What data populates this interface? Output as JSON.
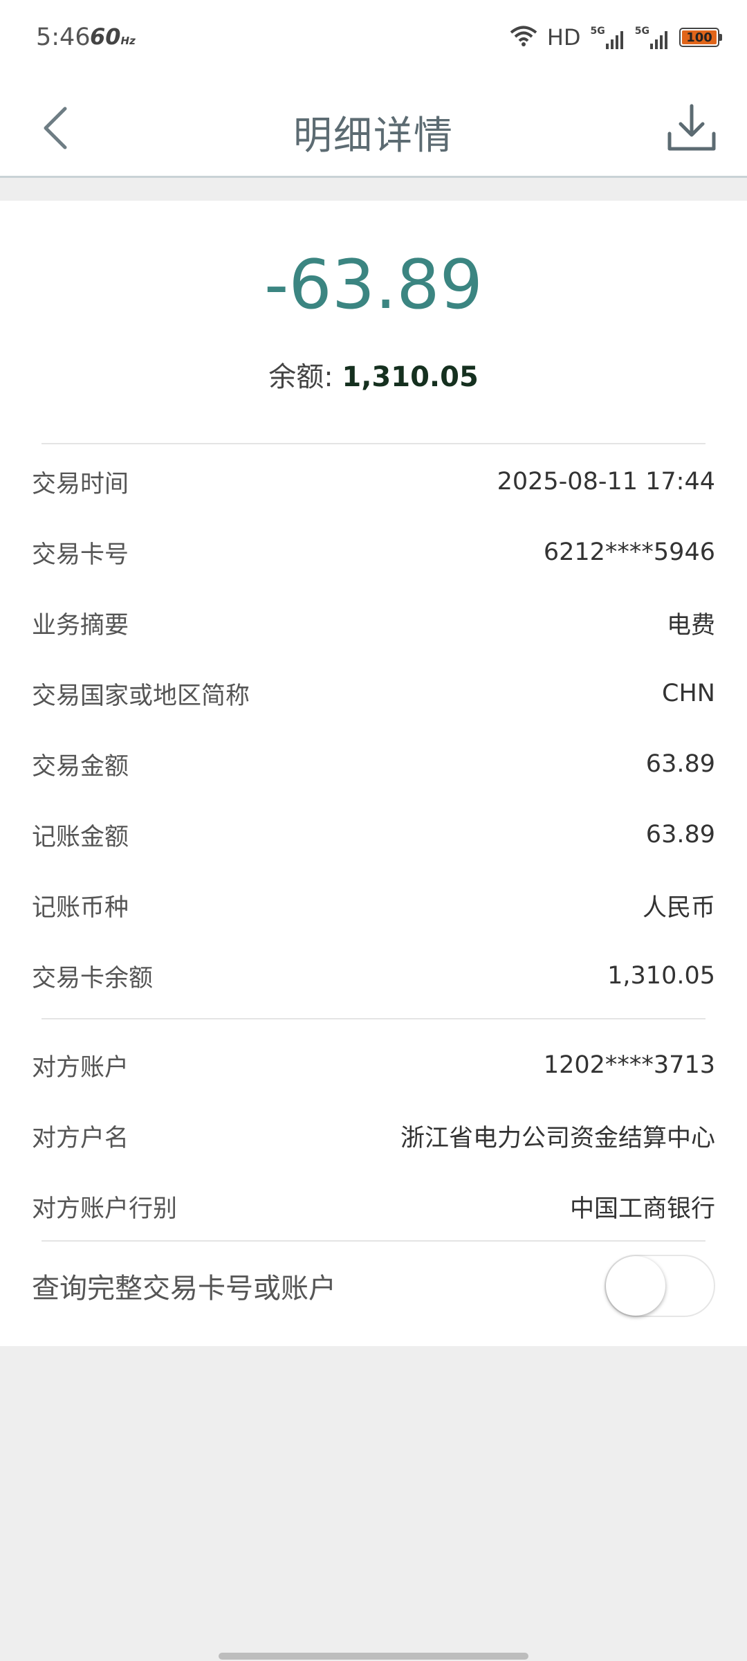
{
  "status_bar": {
    "time": "5:46",
    "refresh_rate": "60",
    "refresh_unit": "Hz",
    "hd_label": "HD",
    "network1": "5G",
    "network2": "5G",
    "battery": "100",
    "battery_level": 1.0,
    "battery_color": "#e0651a"
  },
  "header": {
    "title": "明细详情",
    "back_icon": "chevron-left-icon",
    "download_icon": "download-icon"
  },
  "summary": {
    "amount": "-63.89",
    "balance_label": "余额: ",
    "balance_value": "1,310.05",
    "amount_color": "#3b8581"
  },
  "details": [
    {
      "label": "交易时间",
      "value": "2025-08-11 17:44"
    },
    {
      "label": "交易卡号",
      "value": "6212****5946"
    },
    {
      "label": "业务摘要",
      "value": "电费"
    },
    {
      "label": "交易国家或地区简称",
      "value": "CHN"
    },
    {
      "label": "交易金额",
      "value": "63.89"
    },
    {
      "label": "记账金额",
      "value": "63.89"
    },
    {
      "label": "记账币种",
      "value": "人民币"
    },
    {
      "label": "交易卡余额",
      "value": "1,310.05"
    }
  ],
  "counterparty": [
    {
      "label": "对方账户",
      "value": "1202****3713"
    },
    {
      "label": "对方户名",
      "value": "浙江省电力公司资金结算中心"
    },
    {
      "label": "对方账户行别",
      "value": "中国工商银行"
    }
  ],
  "toggle": {
    "label": "查询完整交易卡号或账户",
    "state": "off"
  }
}
